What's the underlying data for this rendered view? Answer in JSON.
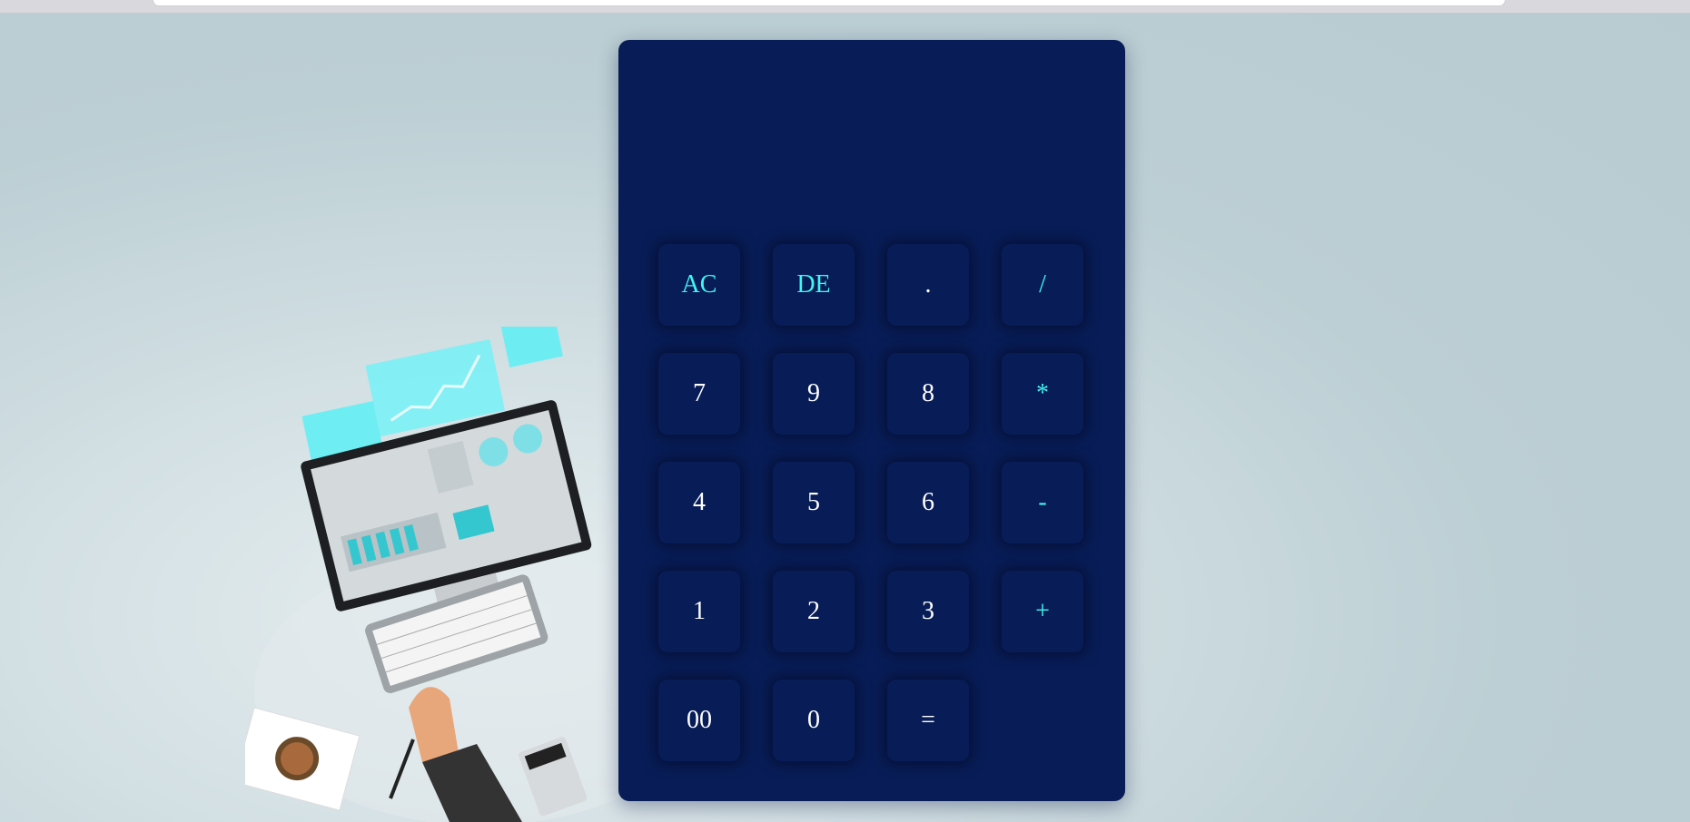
{
  "calculator": {
    "display_value": "",
    "keys": {
      "ac": "AC",
      "de": "DE",
      "dot": ".",
      "divide": "/",
      "seven": "7",
      "nine": "9",
      "eight": "8",
      "multiply": "*",
      "four": "4",
      "five": "5",
      "six": "6",
      "minus": "-",
      "one": "1",
      "two": "2",
      "three": "3",
      "plus": "+",
      "double_zero": "00",
      "zero": "0",
      "equals": "="
    }
  },
  "colors": {
    "panel": "#081d57",
    "operator_text": "#3ff6f0",
    "digit_text": "#ffffff",
    "background": "#b7cbd1"
  }
}
